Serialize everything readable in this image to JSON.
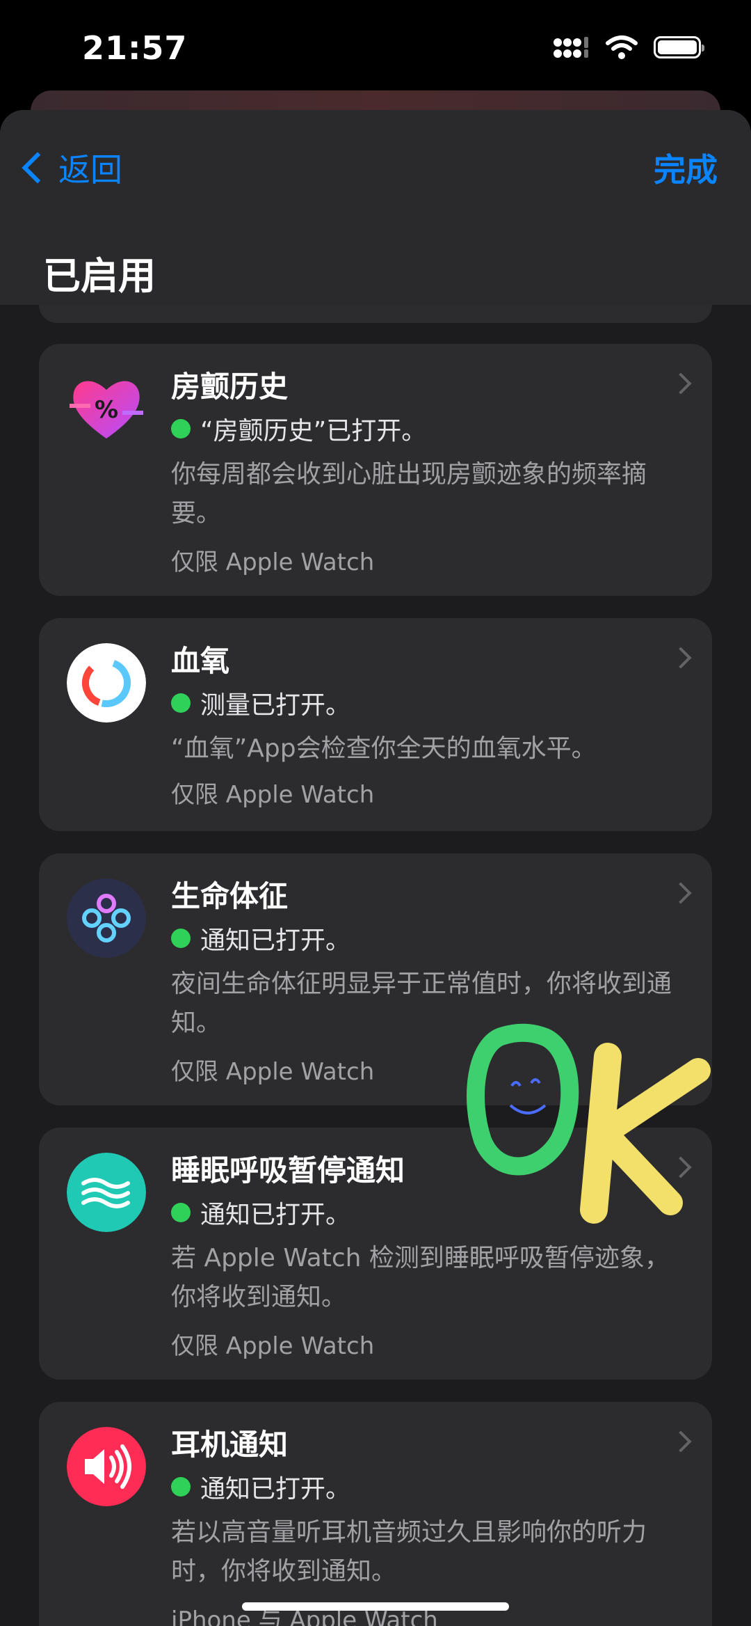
{
  "status_bar": {
    "time": "21:57"
  },
  "nav": {
    "back_label": "返回",
    "done_label": "完成"
  },
  "section": {
    "title": "已启用"
  },
  "cards": [
    {
      "title": "房颤历史",
      "status": "“房颤历史”已打开。",
      "description": "你每周都会收到心脏出现房颤迹象的频率摘要。",
      "footnote": "仅限 Apple Watch",
      "icon": "afib-history-heart-icon"
    },
    {
      "title": "血氧",
      "status": "测量已打开。",
      "description": "“血氧”App会检查你全天的血氧水平。",
      "footnote": "仅限 Apple Watch",
      "icon": "blood-oxygen-icon"
    },
    {
      "title": "生命体征",
      "status": "通知已打开。",
      "description": "夜间生命体征明显异于正常值时，你将收到通知。",
      "footnote": "仅限 Apple Watch",
      "icon": "vitals-icon"
    },
    {
      "title": "睡眠呼吸暂停通知",
      "status": "通知已打开。",
      "description": "若 Apple Watch 检测到睡眠呼吸暂停迹象，你将收到通知。",
      "footnote": "仅限 Apple Watch",
      "icon": "sleep-apnea-icon"
    },
    {
      "title": "耳机通知",
      "status": "通知已打开。",
      "description": "若以高音量听耳机音频过久且影响你的听力时，你将收到通知。",
      "footnote": "iPhone 与 Apple Watch",
      "icon": "headphone-speaker-icon"
    }
  ],
  "sticker": {
    "text": "OK"
  },
  "colors": {
    "accent": "#0a84ff",
    "status_green": "#30d158",
    "card": "#2c2c2e",
    "background": "#1c1c1e"
  }
}
